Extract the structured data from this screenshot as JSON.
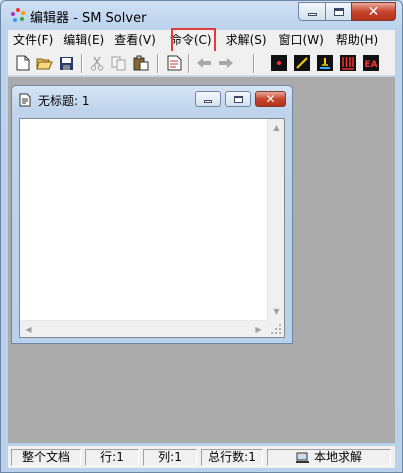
{
  "window": {
    "title": "编辑器 - SM Solver"
  },
  "menu": {
    "items": [
      {
        "label": "文件(F)"
      },
      {
        "label": "编辑(E)"
      },
      {
        "label": "查看(V)"
      },
      {
        "label": "命令(C)"
      },
      {
        "label": "求解(S)"
      },
      {
        "label": "窗口(W)"
      },
      {
        "label": "帮助(H)"
      }
    ]
  },
  "toolbar": {
    "buttons": [
      "new-file-icon",
      "open-folder-icon",
      "save-icon",
      "cut-icon",
      "copy-icon",
      "paste-icon",
      "command-icon",
      "back-arrow-icon",
      "forward-arrow-icon",
      "point-icon",
      "line-icon",
      "support-icon",
      "distributed-load-icon",
      "ea-icon"
    ],
    "ea_label": "EA"
  },
  "document": {
    "title": "无标题: 1",
    "content": ""
  },
  "status": {
    "scope": "整个文档",
    "row": "行:1",
    "col": "列:1",
    "total_rows": "总行数:1",
    "mode": "本地求解"
  }
}
